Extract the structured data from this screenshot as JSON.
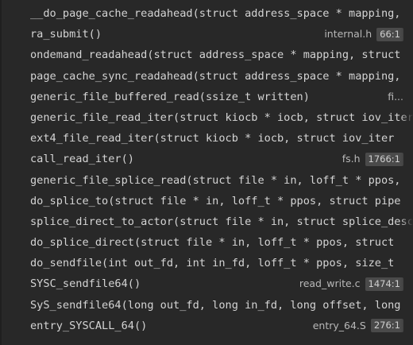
{
  "frames": [
    {
      "fn": "__do_page_cache_readahead(struct address_space * mapping,",
      "file": "",
      "pos": ""
    },
    {
      "fn": "ra_submit()",
      "file": "internal.h",
      "pos": "66:1"
    },
    {
      "fn": "ondemand_readahead(struct address_space * mapping, struct",
      "file": "",
      "pos": ""
    },
    {
      "fn": "page_cache_sync_readahead(struct address_space * mapping,",
      "file": "",
      "pos": ""
    },
    {
      "fn": "generic_file_buffered_read(ssize_t written)",
      "file": "fi...",
      "pos": ""
    },
    {
      "fn": "generic_file_read_iter(struct kiocb * iocb, struct iov_iter",
      "file": "",
      "pos": ""
    },
    {
      "fn": "ext4_file_read_iter(struct kiocb * iocb, struct iov_iter",
      "file": "",
      "pos": ""
    },
    {
      "fn": "call_read_iter()",
      "file": "fs.h",
      "pos": "1766:1"
    },
    {
      "fn": "generic_file_splice_read(struct file * in, loff_t * ppos,",
      "file": "",
      "pos": ""
    },
    {
      "fn": "do_splice_to(struct file * in, loff_t * ppos, struct pipe",
      "file": "",
      "pos": ""
    },
    {
      "fn": "splice_direct_to_actor(struct file * in, struct splice_desc",
      "file": "",
      "pos": ""
    },
    {
      "fn": "do_splice_direct(struct file * in, loff_t * ppos, struct",
      "file": "",
      "pos": ""
    },
    {
      "fn": "do_sendfile(int out_fd, int in_fd, loff_t * ppos, size_t",
      "file": "",
      "pos": ""
    },
    {
      "fn": "SYSC_sendfile64()",
      "file": "read_write.c",
      "pos": "1474:1"
    },
    {
      "fn": "SyS_sendfile64(long out_fd, long in_fd, long offset, long",
      "file": "",
      "pos": ""
    },
    {
      "fn": "entry_SYSCALL_64()",
      "file": "entry_64.S",
      "pos": "276:1"
    }
  ]
}
